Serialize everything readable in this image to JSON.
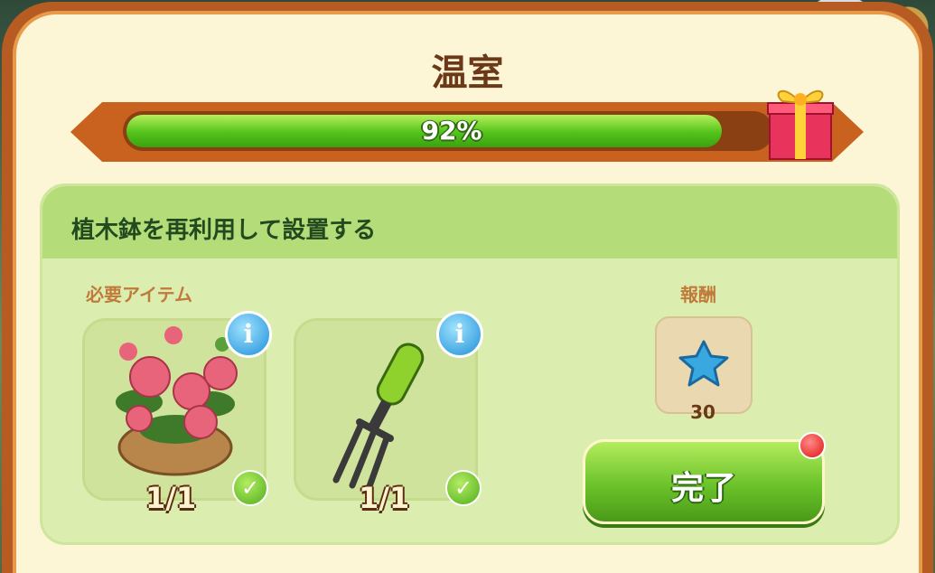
{
  "dialog": {
    "title": "温室",
    "progress_text": "92%",
    "progress": 0.92
  },
  "task": {
    "description": "植木鉢を再利用して設置する",
    "required_label": "必要アイテム",
    "reward_label": "報酬"
  },
  "items": [
    {
      "icon": "peony-pot-icon",
      "count": "1/1"
    },
    {
      "icon": "garden-fork-icon",
      "count": "1/1"
    }
  ],
  "reward": {
    "icon": "blue-star-icon",
    "count": "30"
  },
  "complete_button": {
    "label": "完了"
  },
  "colors": {
    "accent_green": "#54c21a",
    "frame_brown": "#b65c22",
    "notification_red": "#e0150f"
  }
}
